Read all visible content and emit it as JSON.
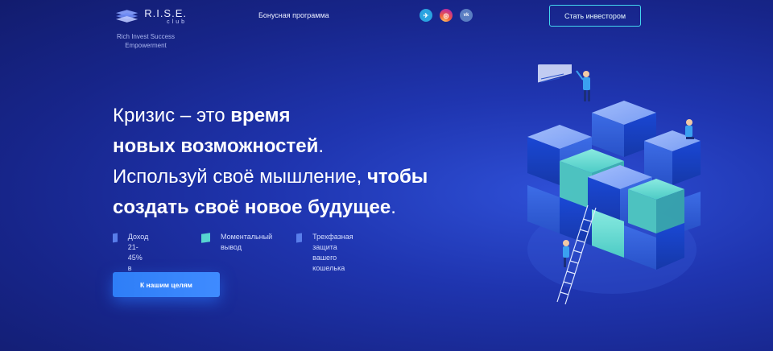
{
  "header": {
    "logo": {
      "title": "R.I.S.E.",
      "sub": "club"
    },
    "tagline_line1": "Rich Invest Success",
    "tagline_line2": "Empowerment",
    "nav_bonus": "Бонусная программа",
    "socials": [
      {
        "icon": "telegram-icon",
        "glyph": "✈"
      },
      {
        "icon": "instagram-icon",
        "glyph": "◎"
      },
      {
        "icon": "vk-icon",
        "glyph": "vk"
      }
    ],
    "invest_button": "Стать инвестором"
  },
  "hero": {
    "l1_regular": "Кризис – это ",
    "l1_bold": "время",
    "l2_bold": "новых возможностей",
    "l2_regular": ".",
    "l3_regular": "Используй своё мышление, ",
    "l3_bold": "чтобы",
    "l4_bold": "создать своё новое будущее",
    "l4_regular": "."
  },
  "features": [
    {
      "line1": "Доход 21-45%",
      "line2": "в месяц"
    },
    {
      "line1": "Моментальный",
      "line2": "вывод"
    },
    {
      "line1": "Трехфазная защита",
      "line2": "вашего кошелька"
    }
  ],
  "cta_button": "К нашим целям",
  "colors": {
    "accent_cyan": "#44d6ef",
    "button_blue": "#2e7ef7",
    "bg_blue": "#1f35b0"
  }
}
